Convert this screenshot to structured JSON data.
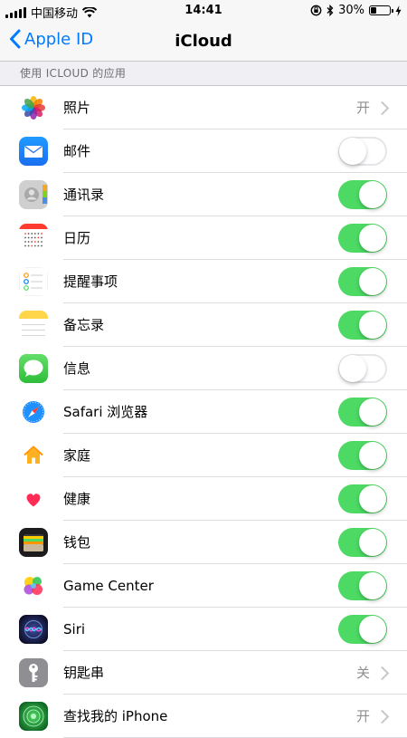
{
  "status_bar": {
    "carrier": "中国移动",
    "time": "14:41",
    "battery_percent": "30%",
    "battery_level": 0.3,
    "icons": [
      "signal-icon",
      "wifi-icon",
      "orientation-lock-icon",
      "bluetooth-icon",
      "battery-icon",
      "charging-icon"
    ]
  },
  "nav": {
    "back_label": "Apple ID",
    "title": "iCloud"
  },
  "section_header": "使用 ICLOUD 的应用",
  "apps": [
    {
      "label": "照片",
      "icon": "photos-icon",
      "type": "detail",
      "detail": "开"
    },
    {
      "label": "邮件",
      "icon": "mail-icon",
      "type": "toggle",
      "on": false
    },
    {
      "label": "通讯录",
      "icon": "contacts-icon",
      "type": "toggle",
      "on": true
    },
    {
      "label": "日历",
      "icon": "calendar-icon",
      "type": "toggle",
      "on": true
    },
    {
      "label": "提醒事项",
      "icon": "reminders-icon",
      "type": "toggle",
      "on": true
    },
    {
      "label": "备忘录",
      "icon": "notes-icon",
      "type": "toggle",
      "on": true
    },
    {
      "label": "信息",
      "icon": "messages-icon",
      "type": "toggle",
      "on": false
    },
    {
      "label": "Safari 浏览器",
      "icon": "safari-icon",
      "type": "toggle",
      "on": true
    },
    {
      "label": "家庭",
      "icon": "home-icon",
      "type": "toggle",
      "on": true
    },
    {
      "label": "健康",
      "icon": "health-icon",
      "type": "toggle",
      "on": true
    },
    {
      "label": "钱包",
      "icon": "wallet-icon",
      "type": "toggle",
      "on": true
    },
    {
      "label": "Game Center",
      "icon": "game-center-icon",
      "type": "toggle",
      "on": true
    },
    {
      "label": "Siri",
      "icon": "siri-icon",
      "type": "toggle",
      "on": true
    },
    {
      "label": "钥匙串",
      "icon": "keychain-icon",
      "type": "detail",
      "detail": "关"
    },
    {
      "label": "查找我的 iPhone",
      "icon": "find-my-iphone-icon",
      "type": "detail",
      "detail": "开"
    }
  ],
  "colors": {
    "accent": "#007aff",
    "toggle_on": "#4cd964",
    "background": "#efeff4"
  }
}
